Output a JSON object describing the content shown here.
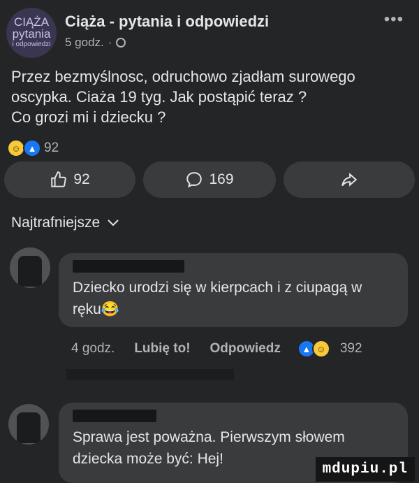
{
  "header": {
    "avatar_lines": [
      "CIĄŻA",
      "pytania",
      "i odpowiedzi"
    ],
    "group_name": "Ciąża - pytania i odpowiedzi",
    "time": "5 godz.",
    "separator": "·",
    "more": "•••"
  },
  "post": {
    "lines": [
      "Przez bezmyślnosc, odruchowo zjadłam surowego",
      "oscypka. Ciaża 19 tyg. Jak postąpić teraz ?",
      "Co grozi mi i dziecku ?"
    ],
    "reaction_count": "92"
  },
  "buttons": {
    "like_count": "92",
    "comment_count": "169"
  },
  "sort_label": "Najtrafniejsze",
  "comments": [
    {
      "lines": [
        "Dziecko urodzi się w kierpcach i z ciupagą w",
        "ręku😂"
      ],
      "time": "4 godz.",
      "like": "Lubię to!",
      "reply": "Odpowiedz",
      "reaction_count": "392"
    },
    {
      "lines": [
        "Sprawa jest poważna. Pierwszym słowem",
        "dziecka może być: Hej!"
      ]
    }
  ],
  "watermark": "mdupiu.pl",
  "colors": {
    "background": "#242526",
    "surface": "#3a3b3c",
    "text": "#e4e6eb",
    "secondary": "#b0b3b8",
    "like_blue": "#1877f2"
  },
  "icons": [
    "globe-icon",
    "more-icon",
    "haha-icon",
    "like-icon",
    "thumbs-up-icon",
    "comment-icon",
    "share-icon",
    "chevron-down-icon"
  ]
}
